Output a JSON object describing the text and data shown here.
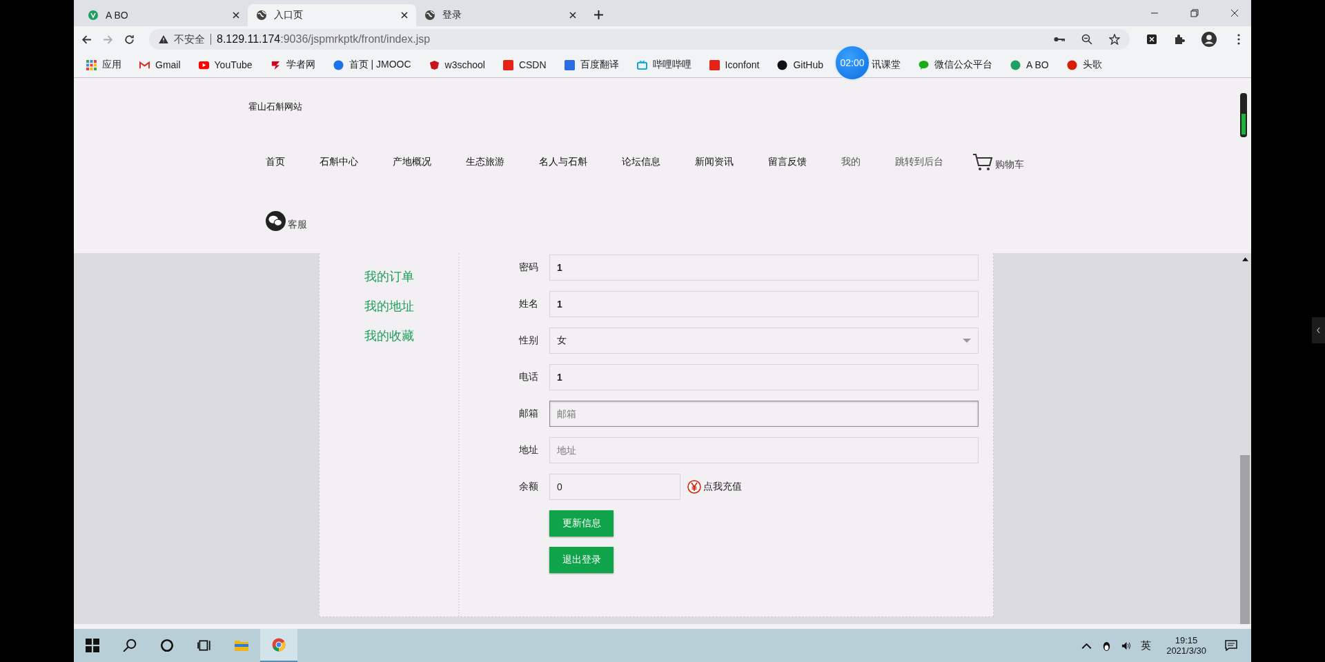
{
  "browser": {
    "tabs": [
      {
        "title": "A BO",
        "selected": false
      },
      {
        "title": "入口页",
        "selected": true
      },
      {
        "title": "登录",
        "selected": false
      }
    ],
    "security_label": "不安全",
    "url_host": "8.129.11.174",
    "url_rest": ":9036/jspmrkptk/front/index.jsp",
    "bookmarks": [
      {
        "label": "应用"
      },
      {
        "label": "Gmail"
      },
      {
        "label": "YouTube"
      },
      {
        "label": "学者网"
      },
      {
        "label": "首页 | JMOOC"
      },
      {
        "label": "w3school"
      },
      {
        "label": "CSDN"
      },
      {
        "label": "百度翻译"
      },
      {
        "label": "哔哩哔哩"
      },
      {
        "label": "Iconfont"
      },
      {
        "label": "GitHub"
      },
      {
        "label": "讯课堂"
      },
      {
        "label": "微信公众平台"
      },
      {
        "label": "A BO"
      },
      {
        "label": "头歌"
      }
    ],
    "recording_timer": "02:00"
  },
  "site": {
    "title": "霍山石斛网站",
    "nav": [
      {
        "label": "首页",
        "muted": false
      },
      {
        "label": "石斛中心",
        "muted": false
      },
      {
        "label": "产地概况",
        "muted": false
      },
      {
        "label": "生态旅游",
        "muted": false
      },
      {
        "label": "名人与石斛",
        "muted": false
      },
      {
        "label": "论坛信息",
        "muted": false
      },
      {
        "label": "新闻资讯",
        "muted": false
      },
      {
        "label": "留言反馈",
        "muted": false
      },
      {
        "label": "我的",
        "muted": true
      },
      {
        "label": "跳转到后台",
        "muted": true
      }
    ],
    "cart": "购物车",
    "service": "客服"
  },
  "sidebar": [
    {
      "label": "我的订单"
    },
    {
      "label": "我的地址"
    },
    {
      "label": "我的收藏"
    }
  ],
  "form": {
    "fields": [
      {
        "label": "密码",
        "kind": "text",
        "value": "1",
        "focused": false
      },
      {
        "label": "姓名",
        "kind": "text",
        "value": "1",
        "focused": false
      },
      {
        "label": "性别",
        "kind": "select",
        "value": "女",
        "focused": false
      },
      {
        "label": "电话",
        "kind": "text",
        "value": "1",
        "focused": false
      },
      {
        "label": "邮箱",
        "kind": "text",
        "placeholder": "邮箱",
        "focused": true
      },
      {
        "label": "地址",
        "kind": "text",
        "placeholder": "地址",
        "focused": false
      }
    ],
    "balance": {
      "label": "余额",
      "value": "0",
      "recharge": "点我充值"
    },
    "buttons": [
      "更新信息",
      "退出登录"
    ]
  },
  "taskbar": {
    "apps": [
      {
        "kind": "start",
        "active": false
      },
      {
        "kind": "search",
        "active": false
      },
      {
        "kind": "cortana",
        "active": false
      },
      {
        "kind": "taskview",
        "active": false
      },
      {
        "kind": "explorer",
        "active": false
      },
      {
        "kind": "chrome",
        "active": true
      }
    ],
    "ime": "英",
    "time": "19:15",
    "date": "2021/3/30"
  }
}
